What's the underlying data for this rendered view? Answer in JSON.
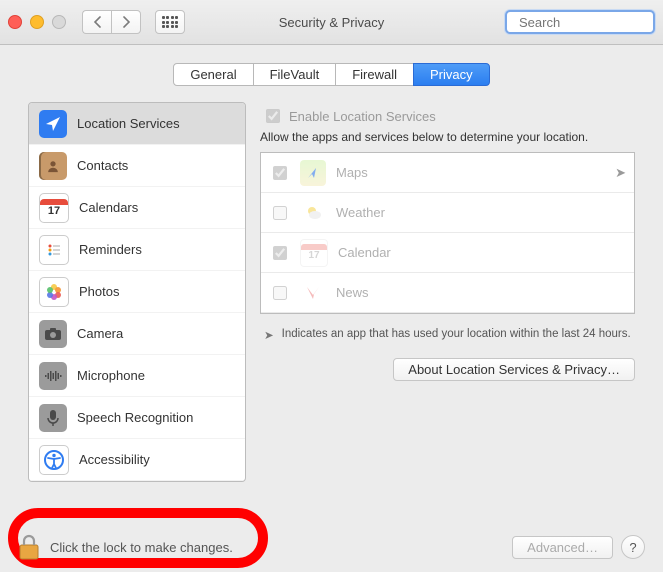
{
  "window": {
    "title": "Security & Privacy"
  },
  "search": {
    "placeholder": "Search"
  },
  "tabs": [
    {
      "label": "General",
      "selected": false
    },
    {
      "label": "FileVault",
      "selected": false
    },
    {
      "label": "Firewall",
      "selected": false
    },
    {
      "label": "Privacy",
      "selected": true
    }
  ],
  "sidebar": {
    "items": [
      {
        "label": "Location Services",
        "icon": "location-arrow-icon",
        "icon_bg": "#2f7cf1",
        "selected": true
      },
      {
        "label": "Contacts",
        "icon": "contacts-icon",
        "icon_bg": "#c89a6a"
      },
      {
        "label": "Calendars",
        "icon": "calendar-icon",
        "icon_bg": "#ffffff"
      },
      {
        "label": "Reminders",
        "icon": "reminders-icon",
        "icon_bg": "#ffffff"
      },
      {
        "label": "Photos",
        "icon": "photos-icon",
        "icon_bg": "#ffffff"
      },
      {
        "label": "Camera",
        "icon": "camera-icon",
        "icon_bg": "#9b9b9b"
      },
      {
        "label": "Microphone",
        "icon": "microphone-icon",
        "icon_bg": "#9b9b9b"
      },
      {
        "label": "Speech Recognition",
        "icon": "speech-icon",
        "icon_bg": "#9b9b9b"
      },
      {
        "label": "Accessibility",
        "icon": "accessibility-icon",
        "icon_bg": "#3074f1"
      }
    ]
  },
  "right": {
    "enable_label": "Enable Location Services",
    "enable_checked": true,
    "description": "Allow the apps and services below to determine your location.",
    "apps": [
      {
        "name": "Maps",
        "checked": true,
        "icon": "maps-icon",
        "indicator": true
      },
      {
        "name": "Weather",
        "checked": false,
        "icon": "weather-icon",
        "indicator": false
      },
      {
        "name": "Calendar",
        "checked": true,
        "icon": "calendar-icon",
        "indicator": false
      },
      {
        "name": "News",
        "checked": false,
        "icon": "news-icon",
        "indicator": false
      }
    ],
    "indicator_note": "Indicates an app that has used your location within the last 24 hours.",
    "about_label": "About Location Services & Privacy…"
  },
  "footer": {
    "lock_text": "Click the lock to make changes.",
    "advanced_label": "Advanced…",
    "help_label": "?"
  }
}
